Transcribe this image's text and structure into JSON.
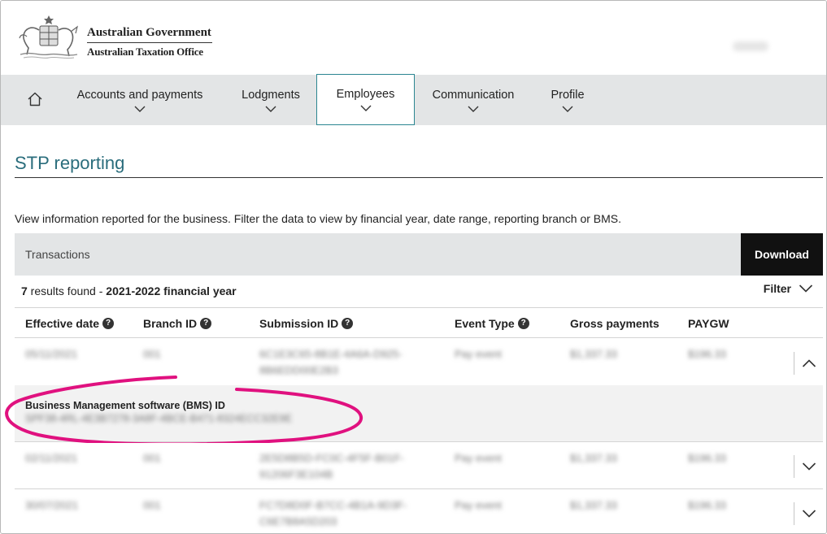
{
  "header": {
    "gov_name": "Australian Government",
    "agency_name": "Australian Taxation Office",
    "crest_icon": "coat-of-arms-icon"
  },
  "nav": {
    "home_icon": "home-icon",
    "items": [
      {
        "label": "Accounts and payments"
      },
      {
        "label": "Lodgments"
      },
      {
        "label": "Employees",
        "active": true
      },
      {
        "label": "Communication"
      },
      {
        "label": "Profile"
      }
    ],
    "accent_color": "#2b8591"
  },
  "page": {
    "title": "STP reporting",
    "intro": "View information reported for the business. Filter the data to view by financial year, date range, reporting branch or BMS."
  },
  "transactions": {
    "label": "Transactions",
    "download_label": "Download",
    "results_count": "7",
    "results_text": " results found - ",
    "results_period": "2021-2022 financial year",
    "filter_label": "Filter"
  },
  "table": {
    "columns": [
      "Effective date",
      "Branch ID",
      "Submission ID",
      "Event Type",
      "Gross payments",
      "PAYGW"
    ],
    "rows": [
      {
        "date": "05/11/2021",
        "branch": "001",
        "submission_line1": "6C1E3C65-8B1E-4A6A-D925-",
        "submission_line2": "8B6EDD00E2B3",
        "event": "Pay event",
        "gross": "$1,337.33",
        "paygw": "$196.33",
        "expanded": true
      },
      {
        "date": "02/11/2021",
        "branch": "001",
        "submission_line1": "2E5D8B5D-FC0C-4F5F-B01F-",
        "submission_line2": "91206F3E104B",
        "event": "Pay event",
        "gross": "$1,337.33",
        "paygw": "$196.33",
        "expanded": false
      },
      {
        "date": "30/07/2021",
        "branch": "001",
        "submission_line1": "FC7D8D0F-B7CC-4B1A-9D3F-",
        "submission_line2": "C6E7B8A5D203",
        "event": "Pay event",
        "gross": "$1,337.33",
        "paygw": "$196.33",
        "expanded": false
      }
    ]
  },
  "bms": {
    "label": "Business Management software (BMS) ID",
    "value": "SPF38-4RL-4E3B7278-3A8F-4BCE-B471-8324ECC32E9E"
  },
  "annotation_color": "#e0117f"
}
